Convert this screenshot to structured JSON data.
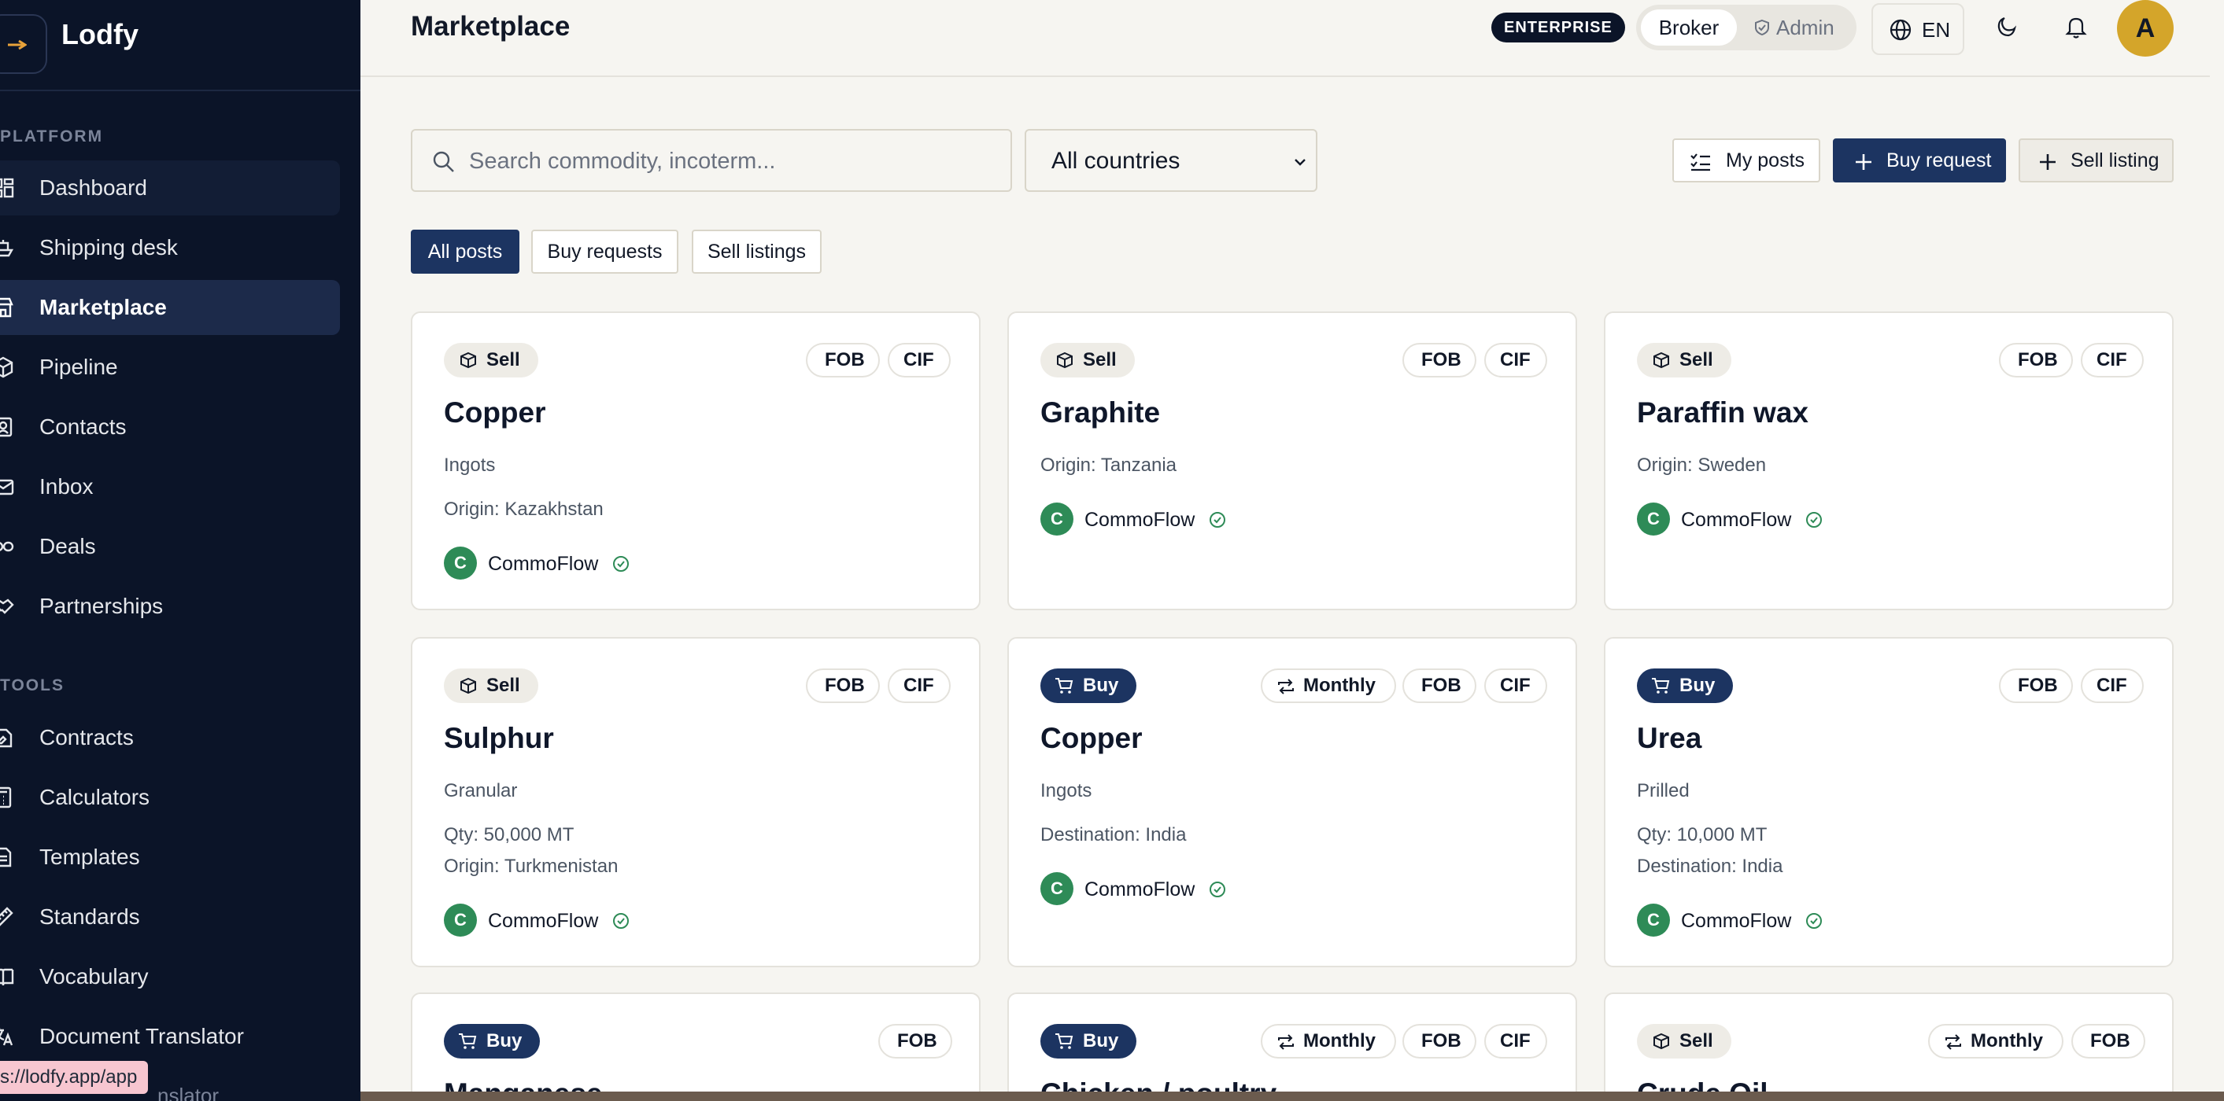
{
  "brand": {
    "name": "Lodfy"
  },
  "sidebar": {
    "sections": [
      {
        "label": "PLATFORM",
        "items": [
          {
            "label": "Dashboard",
            "icon": "dashboard-icon"
          },
          {
            "label": "Shipping desk",
            "icon": "ship-icon"
          },
          {
            "label": "Marketplace",
            "icon": "store-icon",
            "active": true
          },
          {
            "label": "Pipeline",
            "icon": "box-icon"
          },
          {
            "label": "Contacts",
            "icon": "contacts-icon"
          },
          {
            "label": "Inbox",
            "icon": "mail-icon"
          },
          {
            "label": "Deals",
            "icon": "link-icon"
          },
          {
            "label": "Partnerships",
            "icon": "handshake-icon"
          }
        ]
      },
      {
        "label": "TOOLS",
        "items": [
          {
            "label": "Contracts",
            "icon": "contract-icon"
          },
          {
            "label": "Calculators",
            "icon": "calculator-icon"
          },
          {
            "label": "Templates",
            "icon": "template-icon"
          },
          {
            "label": "Standards",
            "icon": "ruler-icon"
          },
          {
            "label": "Vocabulary",
            "icon": "book-icon"
          },
          {
            "label": "Document Translator",
            "icon": "translate-icon"
          }
        ]
      }
    ],
    "status_url": "s://lodfy.app/app",
    "clipped_item": "nslator"
  },
  "header": {
    "title": "Marketplace",
    "plan_badge": "ENTERPRISE",
    "roles": {
      "broker": "Broker",
      "admin": "Admin"
    },
    "language": "EN",
    "avatar_initial": "A"
  },
  "toolbar": {
    "search_placeholder": "Search commodity, incoterm...",
    "country_filter": "All countries",
    "my_posts": "My posts",
    "buy_request": "Buy request",
    "sell_listing": "Sell listing"
  },
  "filter_tabs": [
    "All posts",
    "Buy requests",
    "Sell listings"
  ],
  "listings": [
    {
      "type": "Sell",
      "tags": [
        "FOB",
        "CIF"
      ],
      "title": "Copper",
      "lines": [
        "Ingots",
        "Origin: Kazakhstan"
      ],
      "company": "CommoFlow",
      "company_initial": "C"
    },
    {
      "type": "Sell",
      "tags": [
        "FOB",
        "CIF"
      ],
      "title": "Graphite",
      "lines": [
        "Origin: Tanzania"
      ],
      "company": "CommoFlow",
      "company_initial": "C"
    },
    {
      "type": "Sell",
      "tags": [
        "FOB",
        "CIF"
      ],
      "title": "Paraffin wax",
      "lines": [
        "Origin: Sweden"
      ],
      "company": "CommoFlow",
      "company_initial": "C"
    },
    {
      "type": "Sell",
      "tags": [
        "FOB",
        "CIF"
      ],
      "title": "Sulphur",
      "lines": [
        "Granular",
        "Qty: 50,000 MT",
        "Origin: Turkmenistan"
      ],
      "company": "CommoFlow",
      "company_initial": "C"
    },
    {
      "type": "Buy",
      "tags": [
        "Monthly",
        "FOB",
        "CIF"
      ],
      "title": "Copper",
      "lines": [
        "Ingots",
        "Destination: India"
      ],
      "company": "CommoFlow",
      "company_initial": "C"
    },
    {
      "type": "Buy",
      "tags": [
        "FOB",
        "CIF"
      ],
      "title": "Urea",
      "lines": [
        "Prilled",
        "Qty: 10,000 MT",
        "Destination: India"
      ],
      "company": "CommoFlow",
      "company_initial": "C"
    },
    {
      "type": "Buy",
      "tags": [
        "FOB"
      ],
      "title": "Manganese"
    },
    {
      "type": "Buy",
      "tags": [
        "Monthly",
        "FOB",
        "CIF"
      ],
      "title": "Chicken / poultry"
    },
    {
      "type": "Sell",
      "tags": [
        "Monthly",
        "FOB"
      ],
      "title": "Crude Oil"
    }
  ],
  "colors": {
    "sidebar_bg": "#0b1428",
    "primary": "#1c3461",
    "verified": "#2e8b57",
    "avatar": "#d4a52a"
  }
}
